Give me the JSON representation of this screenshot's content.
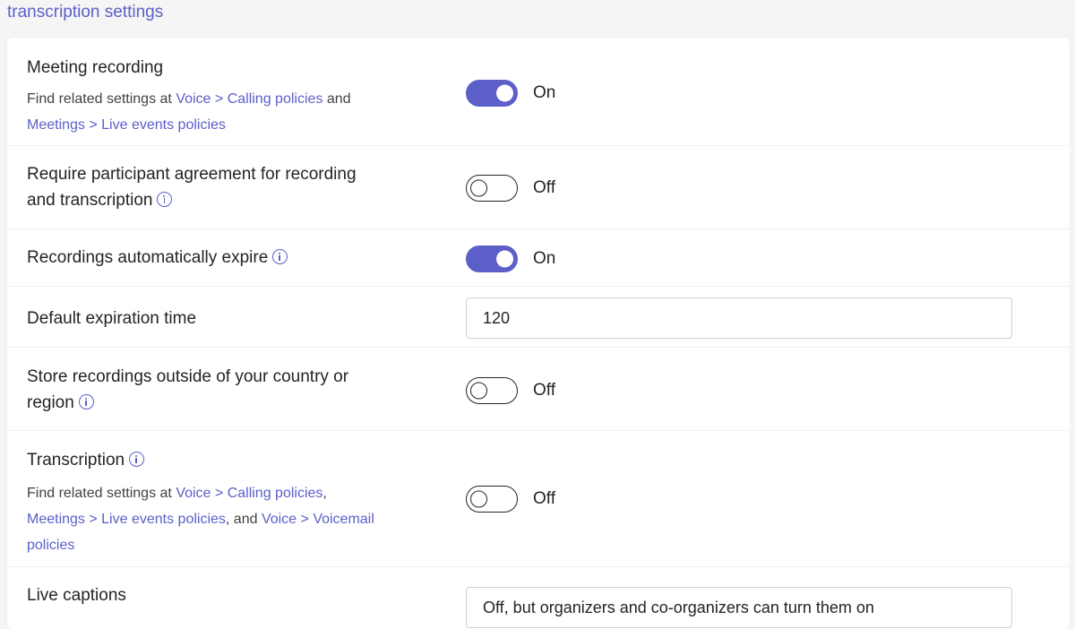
{
  "section_title": "transcription settings",
  "rows": [
    {
      "label": "Meeting recording",
      "desc": {
        "prefix": "Find related settings at ",
        "link1": "Voice > Calling policies",
        "mid": " and",
        "link2": "Meetings > Live events policies"
      },
      "toggle": {
        "state": "on",
        "text": "On"
      }
    },
    {
      "label_line1": "Require participant agreement for recording",
      "label_line2": "and transcription",
      "info_icon": "info-icon",
      "toggle": {
        "state": "off",
        "text": "Off"
      }
    },
    {
      "label": "Recordings automatically expire",
      "info_icon": "info-icon",
      "toggle": {
        "state": "on",
        "text": "On"
      }
    },
    {
      "label": "Default expiration time",
      "input_value": "120"
    },
    {
      "label_line1": "Store recordings outside of your country or",
      "label_line2": "region",
      "info_icon": "info-icon",
      "toggle": {
        "state": "off",
        "text": "Off"
      }
    },
    {
      "label": "Transcription",
      "info_icon": "info-icon",
      "desc": {
        "prefix": "Find related settings at ",
        "link1": "Voice > Calling policies",
        "sep1": ",",
        "link2": "Meetings > Live events policies",
        "sep2": ", and ",
        "link3": "Voice > Voicemail",
        "link4": "policies"
      },
      "toggle": {
        "state": "off",
        "text": "Off"
      }
    },
    {
      "label": "Live captions",
      "dropdown_value": "Off, but organizers and co-organizers can turn them on"
    }
  ],
  "colors": {
    "accent": "#5b5fc7",
    "text": "#242424",
    "background": "#f5f5f5",
    "card": "#ffffff"
  }
}
